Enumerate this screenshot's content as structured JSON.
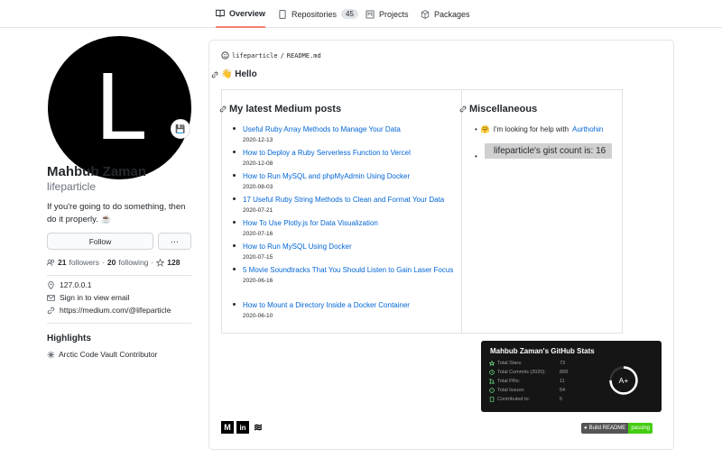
{
  "nav": {
    "overview": "Overview",
    "repositories": "Repositories",
    "repositories_count": "45",
    "projects": "Projects",
    "packages": "Packages"
  },
  "profile": {
    "avatar_letter": "L",
    "status_emoji": "💾",
    "fullname": "Mahbub Zaman",
    "username": "lifeparticle",
    "bio": "If you're going to do something, then do it properly. ☕",
    "follow_label": "Follow",
    "more_label": "···",
    "followers_count": "21",
    "followers_label": "followers",
    "following_count": "20",
    "following_label": "following",
    "stars_count": "128",
    "location": "127.0.0.1",
    "email": "Sign in to view email",
    "website": "https://medium.com/@lifeparticle"
  },
  "highlights": {
    "title": "Highlights",
    "item": "Arctic Code Vault Contributor"
  },
  "readme": {
    "path_owner": "lifeparticle",
    "path_sep": "/",
    "path_file": "README",
    "path_ext": ".md",
    "hello": "👋 Hello",
    "posts_title": "My latest Medium posts",
    "posts": [
      {
        "title": "Useful Ruby Array Methods to Manage Your Data",
        "date": "2020-12-13"
      },
      {
        "title": "How to Deploy a Ruby Serverless Function to Vercel",
        "date": "2020-12-08"
      },
      {
        "title": "How to Run MySQL and phpMyAdmin Using Docker",
        "date": "2020-08-03"
      },
      {
        "title": "17 Useful Ruby String Methods to Clean and Format Your Data",
        "date": "2020-07-21"
      },
      {
        "title": "How To Use Plotly.js for Data Visualization",
        "date": "2020-07-16"
      },
      {
        "title": "How to Run MySQL Using Docker",
        "date": "2020-07-15"
      },
      {
        "title": "5 Movie Soundtracks That You Should Listen to Gain Laser Focus",
        "date": "2020-06-16"
      },
      {
        "title": "How to Mount a Directory Inside a Docker Container",
        "date": "2020-06-10"
      }
    ],
    "misc_title": "Miscellaneous",
    "misc_help_prefix": "I'm looking for help with",
    "misc_help_link": "Aurthohin",
    "gist_text": "lifeparticle's gist count is: 16"
  },
  "stats_card": {
    "title": "Mahbub Zaman's GitHub Stats",
    "rows": [
      {
        "label": "Total Stars:",
        "value": "73"
      },
      {
        "label": "Total Commits (2020):",
        "value": "899"
      },
      {
        "label": "Total PRs:",
        "value": "11"
      },
      {
        "label": "Total Issues:",
        "value": "54"
      },
      {
        "label": "Contributed to:",
        "value": "5"
      }
    ],
    "grade": "A+",
    "grade_progress": 0.75
  },
  "socials": [
    "M",
    "in",
    "≋"
  ],
  "build_badge": {
    "left": "Build README",
    "right": "passing"
  },
  "colors": {
    "link": "#0366d6",
    "tab_accent": "#f9826c",
    "badge_green": "#4c1"
  }
}
